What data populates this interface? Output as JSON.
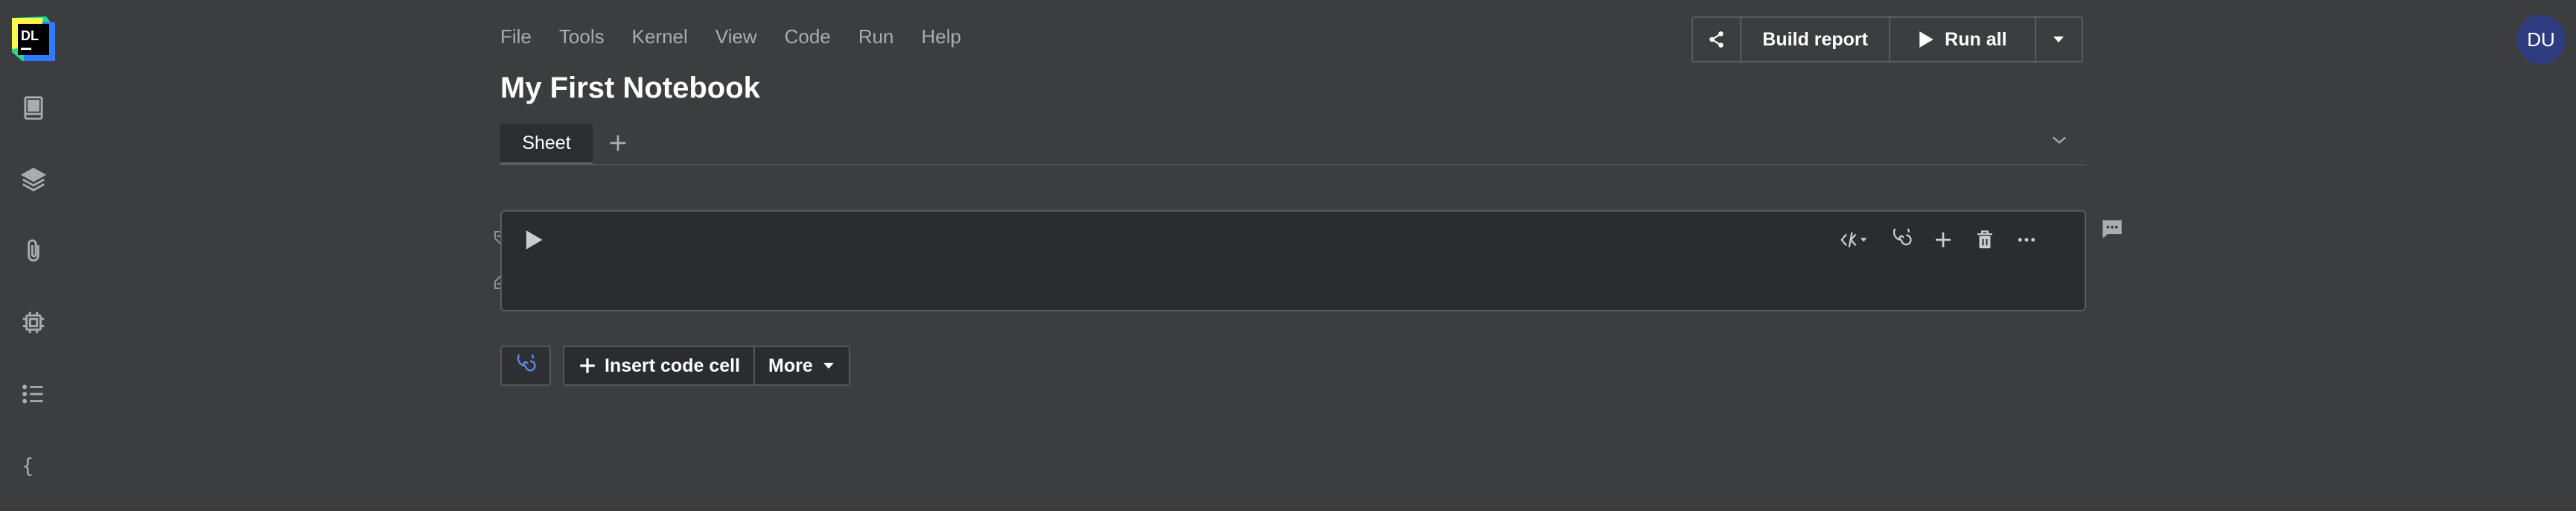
{
  "app": {
    "logo_text": "DL"
  },
  "menu": [
    "File",
    "Tools",
    "Kernel",
    "View",
    "Code",
    "Run",
    "Help"
  ],
  "notebook": {
    "title": "My First Notebook"
  },
  "tabs": {
    "items": [
      "Sheet"
    ]
  },
  "toolbar": {
    "build_report": "Build report",
    "run_all": "Run all"
  },
  "user": {
    "initials": "DU"
  },
  "actions": {
    "insert_code_cell": "Insert code cell",
    "more": "More"
  }
}
